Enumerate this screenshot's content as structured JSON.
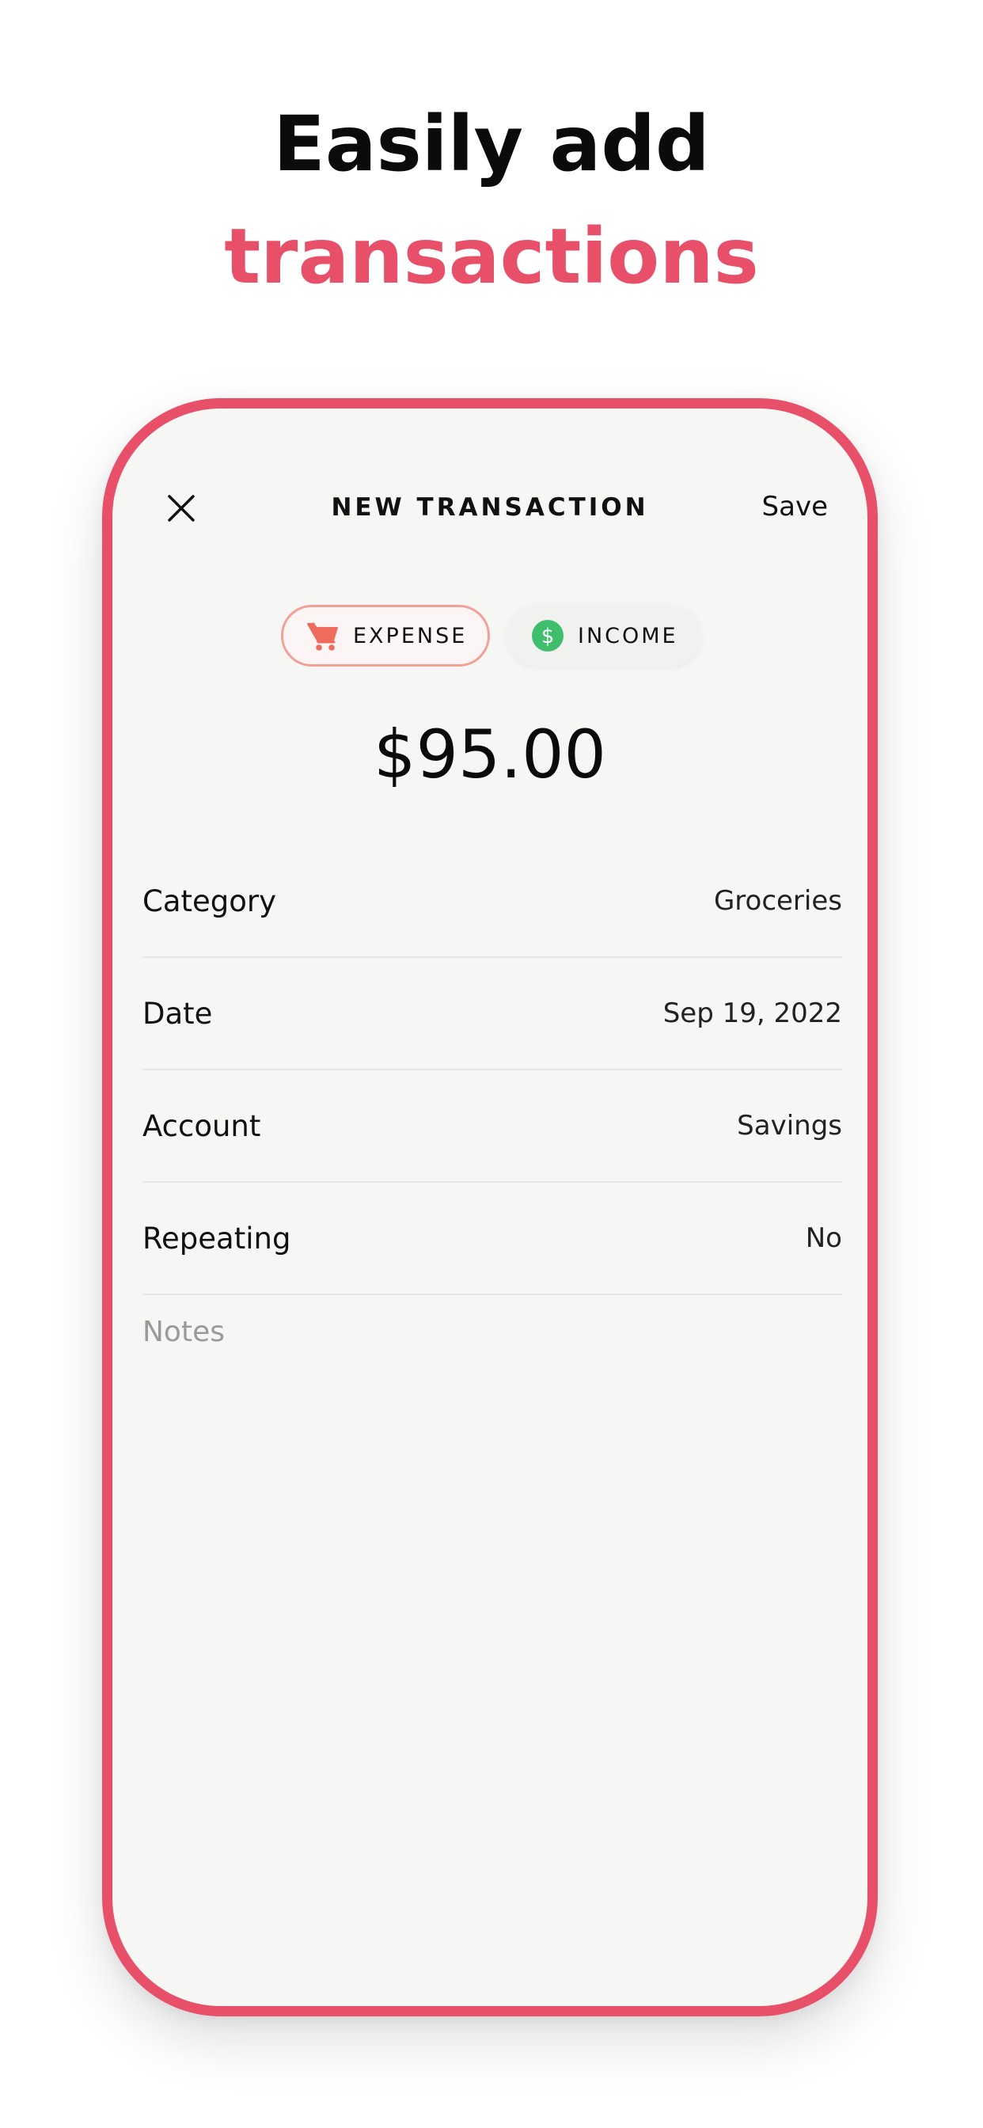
{
  "headline": {
    "line1": "Easily add",
    "line2": "transactions"
  },
  "colors": {
    "accent": "#e8506a",
    "expense_border": "#f2a096",
    "cart_icon": "#ef6b5e",
    "income_icon": "#3fbf6e"
  },
  "nav": {
    "close_icon": "close-icon",
    "title": "NEW TRANSACTION",
    "save_label": "Save"
  },
  "type_toggle": {
    "expense": {
      "label": "EXPENSE",
      "icon": "cart-icon",
      "selected": true
    },
    "income": {
      "label": "INCOME",
      "icon": "dollar-icon",
      "selected": false
    }
  },
  "amount": "$95.00",
  "fields": [
    {
      "label": "Category",
      "value": "Groceries"
    },
    {
      "label": "Date",
      "value": "Sep 19, 2022"
    },
    {
      "label": "Account",
      "value": "Savings"
    },
    {
      "label": "Repeating",
      "value": "No"
    }
  ],
  "notes": {
    "placeholder": "Notes"
  }
}
